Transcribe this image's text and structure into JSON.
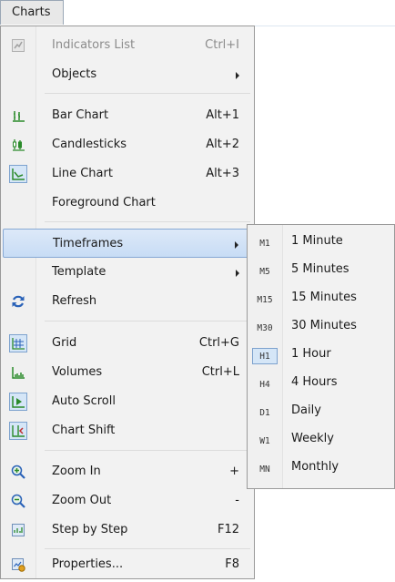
{
  "menubar": {
    "charts_label": "Charts"
  },
  "menu": {
    "indicators_list": {
      "label": "Indicators List",
      "shortcut": "Ctrl+I"
    },
    "objects": {
      "label": "Objects"
    },
    "bar_chart": {
      "label": "Bar Chart",
      "shortcut": "Alt+1"
    },
    "candlesticks": {
      "label": "Candlesticks",
      "shortcut": "Alt+2"
    },
    "line_chart": {
      "label": "Line Chart",
      "shortcut": "Alt+3"
    },
    "foreground_chart": {
      "label": "Foreground Chart"
    },
    "timeframes": {
      "label": "Timeframes"
    },
    "template": {
      "label": "Template"
    },
    "refresh": {
      "label": "Refresh"
    },
    "grid": {
      "label": "Grid",
      "shortcut": "Ctrl+G"
    },
    "volumes": {
      "label": "Volumes",
      "shortcut": "Ctrl+L"
    },
    "auto_scroll": {
      "label": "Auto Scroll"
    },
    "chart_shift": {
      "label": "Chart Shift"
    },
    "zoom_in": {
      "label": "Zoom In",
      "shortcut": "+"
    },
    "zoom_out": {
      "label": "Zoom Out",
      "shortcut": "-"
    },
    "step_by_step": {
      "label": "Step by Step",
      "shortcut": "F12"
    },
    "properties": {
      "label": "Properties...",
      "shortcut": "F8"
    }
  },
  "timeframes": [
    {
      "code": "M1",
      "label": "1 Minute"
    },
    {
      "code": "M5",
      "label": "5 Minutes"
    },
    {
      "code": "M15",
      "label": "15 Minutes"
    },
    {
      "code": "M30",
      "label": "30 Minutes"
    },
    {
      "code": "H1",
      "label": "1 Hour"
    },
    {
      "code": "H4",
      "label": "4 Hours"
    },
    {
      "code": "D1",
      "label": "Daily"
    },
    {
      "code": "W1",
      "label": "Weekly"
    },
    {
      "code": "MN",
      "label": "Monthly"
    }
  ],
  "colors": {
    "highlight": "#c7dcf5",
    "checked_bg": "#d5e6f7",
    "checked_border": "#7da2ce",
    "icon_green": "#2a8a2a",
    "icon_blue": "#2a62b8"
  }
}
